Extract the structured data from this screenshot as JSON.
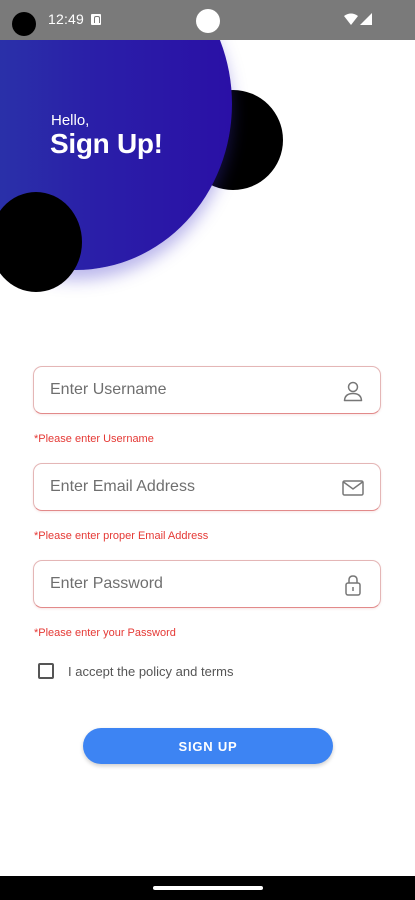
{
  "status_bar": {
    "time": "12:49"
  },
  "header": {
    "greeting": "Hello,",
    "title": "Sign Up!"
  },
  "form": {
    "username": {
      "placeholder": "Enter Username",
      "value": "",
      "error": "*Please enter Username",
      "icon": "person-icon"
    },
    "email": {
      "placeholder": "Enter Email Address",
      "value": "",
      "error": "*Please enter proper Email Address",
      "icon": "mail-icon"
    },
    "password": {
      "placeholder": "Enter Password",
      "value": "",
      "error": "*Please enter your Password",
      "icon": "lock-icon"
    },
    "policy": {
      "label": "I accept the policy and terms",
      "checked": false
    },
    "submit_label": "SIGN UP"
  },
  "colors": {
    "primary_gradient_start": "#2b40aa",
    "primary_gradient_end": "#2a10a6",
    "button": "#3d84f3",
    "error": "#e53935",
    "status_bar": "#7a7a7a"
  }
}
